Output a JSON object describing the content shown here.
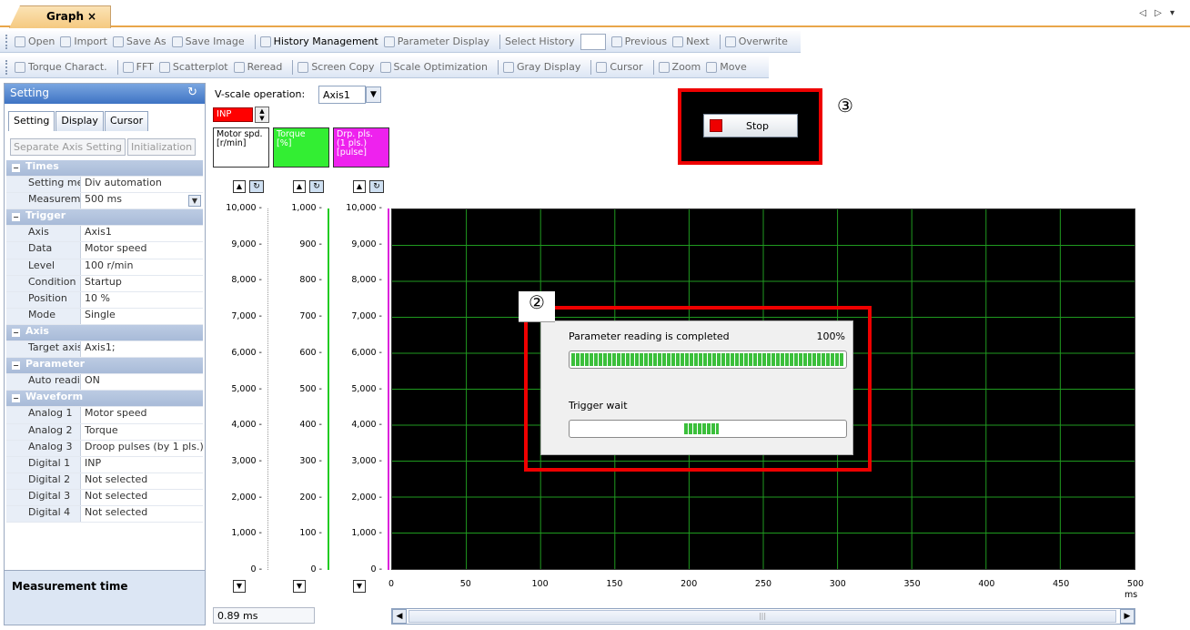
{
  "tab": {
    "title": "Graph",
    "close": "×",
    "nav": "◁ ▷ ▾"
  },
  "toolbar1": [
    {
      "label": "Open",
      "icon": "open-icon"
    },
    {
      "label": "Import",
      "icon": "import-icon"
    },
    {
      "label": "Save As",
      "icon": "save-icon"
    },
    {
      "label": "Save Image",
      "icon": "save-image-icon"
    },
    {
      "label": "History Management",
      "icon": "history-icon"
    },
    {
      "label": "Parameter Display",
      "icon": "parameter-display-icon"
    },
    {
      "label": "Select History"
    },
    {
      "label": "Previous",
      "icon": "previous-icon"
    },
    {
      "label": "Next",
      "icon": "next-icon"
    },
    {
      "label": "Overwrite",
      "icon": "overwrite-icon"
    }
  ],
  "toolbar2": [
    {
      "label": "Torque Charact.",
      "icon": "torque-icon"
    },
    {
      "label": "FFT",
      "icon": "fft-icon"
    },
    {
      "label": "Scatterplot",
      "icon": "scatterplot-icon"
    },
    {
      "label": "Reread",
      "icon": "reread-icon"
    },
    {
      "label": "Screen Copy",
      "icon": "screen-copy-icon"
    },
    {
      "label": "Scale Optimization",
      "icon": "scale-optimization-icon"
    },
    {
      "label": "Gray Display",
      "icon": "gray-display-icon"
    },
    {
      "label": "Cursor",
      "icon": "cursor-icon"
    },
    {
      "label": "Zoom",
      "icon": "zoom-icon"
    },
    {
      "label": "Move",
      "icon": "move-icon"
    }
  ],
  "panel": {
    "title": "Setting",
    "tabs": [
      "Setting",
      "Display",
      "Cursor"
    ],
    "buttons": [
      "Separate Axis Setting",
      "Initialization"
    ],
    "description_title": "Measurement time"
  },
  "properties": [
    {
      "cat": "Times"
    },
    {
      "k": "Setting meth",
      "v": "Div automation"
    },
    {
      "k": "Measuremen",
      "v": "500 ms",
      "dropdown": true
    },
    {
      "cat": "Trigger"
    },
    {
      "k": "Axis",
      "v": "Axis1"
    },
    {
      "k": "Data",
      "v": "Motor speed"
    },
    {
      "k": "Level",
      "v": "100 r/min"
    },
    {
      "k": "Condition",
      "v": "Startup"
    },
    {
      "k": "Position",
      "v": "10 %"
    },
    {
      "k": "Mode",
      "v": "Single"
    },
    {
      "cat": "Axis"
    },
    {
      "k": "Target axis",
      "v": "Axis1;"
    },
    {
      "cat": "Parameter"
    },
    {
      "k": "Auto reading",
      "v": "ON"
    },
    {
      "cat": "Waveform"
    },
    {
      "k": "Analog 1",
      "v": "Motor speed"
    },
    {
      "k": "Analog 2",
      "v": "Torque"
    },
    {
      "k": "Analog 3",
      "v": "Droop pulses (by 1 pls.)"
    },
    {
      "k": "Digital 1",
      "v": "INP"
    },
    {
      "k": "Digital 2",
      "v": "Not selected"
    },
    {
      "k": "Digital 3",
      "v": "Not selected"
    },
    {
      "k": "Digital 4",
      "v": "Not selected"
    }
  ],
  "vscale": {
    "label": "V-scale operation:",
    "value": "Axis1"
  },
  "inp_label": "INP",
  "channels": [
    {
      "name": "Motor spd.\n[r/min]",
      "color": "#ffffff",
      "line": "#000000",
      "ticks": [
        "10,000",
        "9,000",
        "8,000",
        "7,000",
        "6,000",
        "5,000",
        "4,000",
        "3,000",
        "2,000",
        "1,000",
        "0"
      ]
    },
    {
      "name": "Torque\n[%]",
      "color": "#33ee33",
      "line": "#22cc22",
      "ticks": [
        "1,000",
        "900",
        "800",
        "700",
        "600",
        "500",
        "400",
        "300",
        "200",
        "100",
        "0"
      ]
    },
    {
      "name": "Drp. pls.\n(1 pls.)\n[pulse]",
      "color": "#ee22ee",
      "line": "#dd22dd",
      "ticks": [
        "10,000",
        "9,000",
        "8,000",
        "7,000",
        "6,000",
        "5,000",
        "4,000",
        "3,000",
        "2,000",
        "1,000",
        "0"
      ]
    }
  ],
  "xaxis": {
    "ticks": [
      "0",
      "50",
      "100",
      "150",
      "200",
      "250",
      "300",
      "350",
      "400",
      "450",
      "500"
    ],
    "unit": "ms"
  },
  "stop": {
    "label": "Stop",
    "marker": "③"
  },
  "dialog": {
    "marker": "②",
    "line1": "Parameter reading is completed",
    "pct": "100%",
    "progress": 1.0,
    "line2": "Trigger wait"
  },
  "time_display": "0.89 ms",
  "colors": {
    "grid": "#1f9a1f",
    "accent": "#e00000"
  }
}
